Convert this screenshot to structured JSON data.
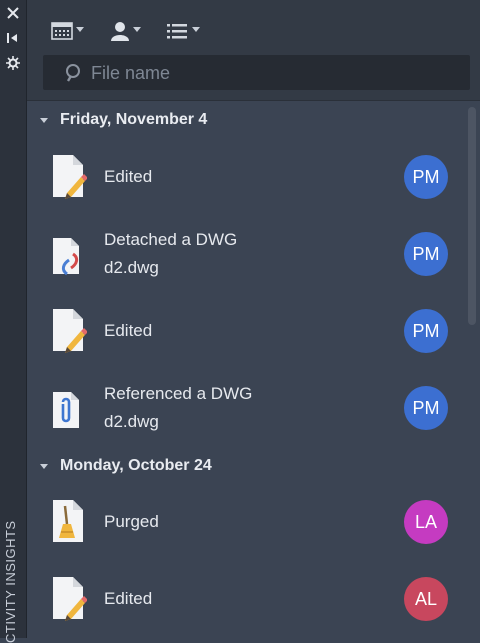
{
  "panel": {
    "side_title": "ACTIVITY INSIGHTS",
    "visible_side_title": "CTIVITY INSIGHTS"
  },
  "toolbar": {
    "icons": [
      "calendar-icon",
      "user-icon",
      "list-icon"
    ]
  },
  "search": {
    "placeholder": "File name",
    "value": ""
  },
  "colors": {
    "pm": "#3c6fd1",
    "la": "#c53bc1",
    "al": "#c8475e",
    "background": "#3b4453"
  },
  "groups": [
    {
      "date": "Friday, November 4",
      "items": [
        {
          "action": "Edited",
          "file": "",
          "user": "PM",
          "icon": "edit-document-icon"
        },
        {
          "action": "Detached a DWG",
          "file": "d2.dwg",
          "user": "PM",
          "icon": "detach-document-icon"
        },
        {
          "action": "Edited",
          "file": "",
          "user": "PM",
          "icon": "edit-document-icon"
        },
        {
          "action": "Referenced a DWG",
          "file": "d2.dwg",
          "user": "PM",
          "icon": "reference-document-icon"
        }
      ]
    },
    {
      "date": "Monday, October 24",
      "items": [
        {
          "action": "Purged",
          "file": "",
          "user": "LA",
          "icon": "purge-document-icon"
        },
        {
          "action": "Edited",
          "file": "",
          "user": "AL",
          "icon": "edit-document-icon"
        }
      ]
    }
  ]
}
